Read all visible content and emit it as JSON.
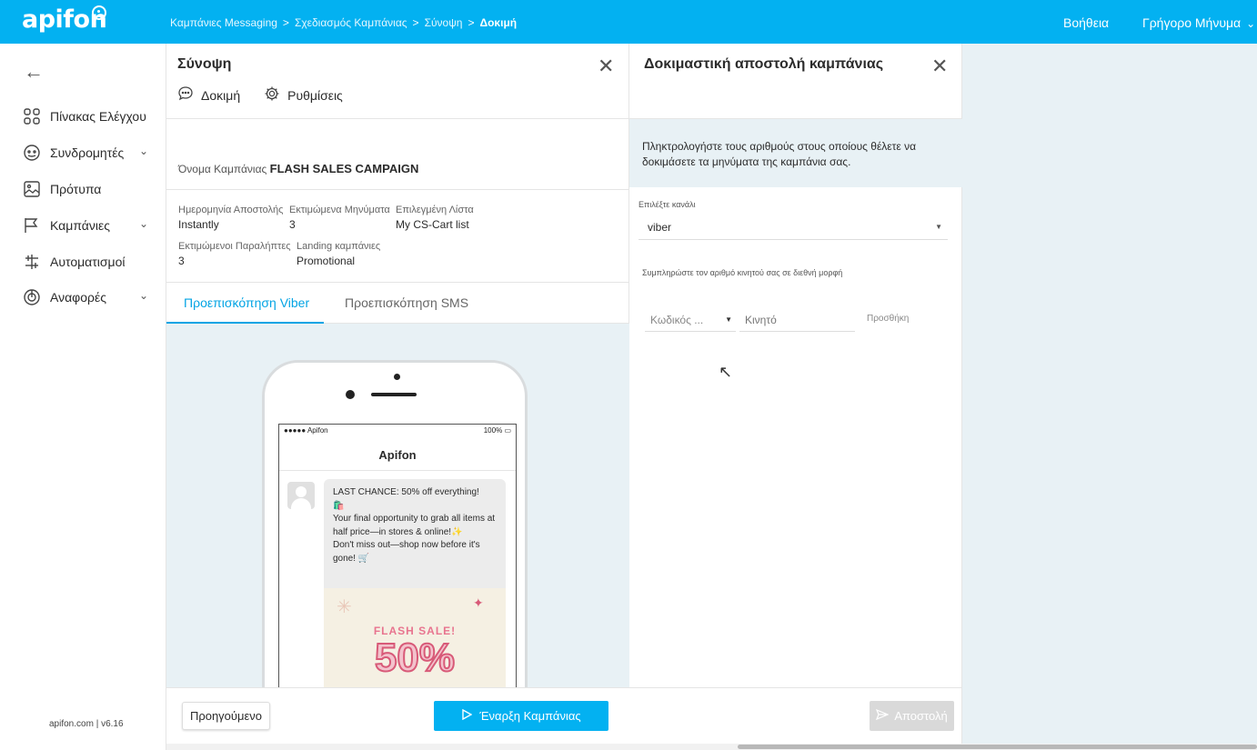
{
  "brand": {
    "logo": "apifon",
    "accent": "#03b1f1"
  },
  "breadcrumbs": [
    {
      "label": "Καμπάνιες Messaging"
    },
    {
      "label": "Σχεδιασμός Καμπάνιας"
    },
    {
      "label": "Σύνοψη"
    },
    {
      "label": "Δοκιμή"
    }
  ],
  "topbar": {
    "help": "Βοήθεια",
    "quick_message": "Γρήγορο Μήνυμα"
  },
  "sidebar": {
    "items": [
      {
        "label": "Πίνακας Ελέγχου",
        "icon": "dashboard-icon"
      },
      {
        "label": "Συνδρομητές",
        "icon": "subscribers-icon"
      },
      {
        "label": "Πρότυπα",
        "icon": "templates-icon"
      },
      {
        "label": "Καμπάνιες",
        "icon": "flag-icon"
      },
      {
        "label": "Αυτοματισμοί",
        "icon": "automation-icon"
      },
      {
        "label": "Αναφορές",
        "icon": "reports-icon"
      }
    ],
    "footer": "apifon.com | v6.16"
  },
  "summary": {
    "title": "Σύνοψη",
    "tools": {
      "test": "Δοκιμή",
      "settings": "Ρυθμίσεις"
    },
    "campaign_name_label": "Όνομα Καμπάνιας",
    "campaign_name": "FLASH SALES CAMPAIGN",
    "fields": {
      "send_date_label": "Ημερομηνία Αποστολής",
      "send_date": "Instantly",
      "est_messages_label": "Εκτιμώμενα Μηνύματα",
      "est_messages": "3",
      "selected_list_label": "Επιλεγμένη Λίστα",
      "selected_list": "My CS-Cart list",
      "est_recipients_label": "Εκτιμώμενοι Παραλήπτες",
      "est_recipients": "3",
      "landing_label": "Landing καμπάνιες",
      "landing": "Promotional"
    },
    "tabs": {
      "viber": "Προεπισκόπηση Viber",
      "sms": "Προεπισκόπηση SMS"
    },
    "buttons": {
      "previous": "Προηγούμενο",
      "start": "Έναρξη Καμπάνιας"
    }
  },
  "phone": {
    "carrier": "●●●●● Apifon",
    "battery": "100%",
    "title": "Apifon",
    "message_lines": [
      "LAST CHANCE: 50% off everything!",
      "🛍️",
      "Your final opportunity to grab all items at half price—in stores & online!✨",
      "Don't miss out—shop now before it's gone! 🛒"
    ],
    "banner": {
      "headline": "FLASH SALE!",
      "big": "50%"
    }
  },
  "test": {
    "title": "Δοκιμαστική αποστολή καμπάνιας",
    "info": "Πληκτρολογήστε τους αριθμούς στους οποίους θέλετε να δοκιμάσετε τα μηνύματα της καμπάνια σας.",
    "channel_label": "Επιλέξτε κανάλι",
    "channel_value": "viber",
    "phone_label": "Συμπληρώστε τον αριθμό κινητού σας σε διεθνή μορφή",
    "code_placeholder": "Κωδικός ...",
    "mobile_placeholder": "Κινητό",
    "add": "Προσθήκη",
    "send": "Αποστολή"
  }
}
